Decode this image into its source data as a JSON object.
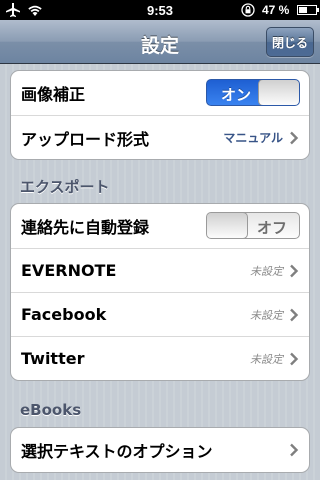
{
  "status_bar": {
    "time": "9:53",
    "battery_text": "47 %"
  },
  "nav": {
    "title": "設定",
    "close_label": "閉じる"
  },
  "group1": {
    "image_correction_label": "画像補正",
    "image_correction_toggle": "オン",
    "upload_format_label": "アップロード形式",
    "upload_format_value": "マニュアル"
  },
  "export_header": "エクスポート",
  "export": {
    "contacts_label": "連絡先に自動登録",
    "contacts_toggle": "オフ",
    "evernote_label": "EVERNOTE",
    "evernote_value": "未設定",
    "facebook_label": "Facebook",
    "facebook_value": "未設定",
    "twitter_label": "Twitter",
    "twitter_value": "未設定"
  },
  "ebooks_header": "eBooks",
  "ebooks": {
    "selection_label": "選択テキストのオプション"
  }
}
